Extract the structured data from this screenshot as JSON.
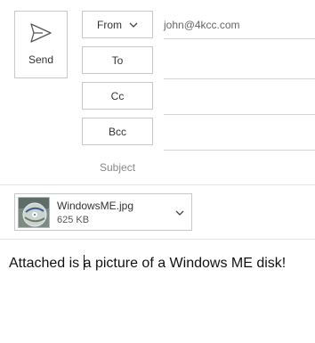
{
  "send": {
    "label": "Send",
    "icon": "send-icon"
  },
  "header": {
    "from_label": "From",
    "from_value": "john@4kcc.com",
    "to_label": "To",
    "cc_label": "Cc",
    "bcc_label": "Bcc",
    "subject_placeholder": "Subject"
  },
  "attachment": {
    "name": "WindowsME.jpg",
    "size": "625 KB",
    "icon": "chevron-down-icon"
  },
  "body": {
    "text_before_caret": "Attached is ",
    "text_after_caret": "a picture of a Windows ME disk!"
  }
}
